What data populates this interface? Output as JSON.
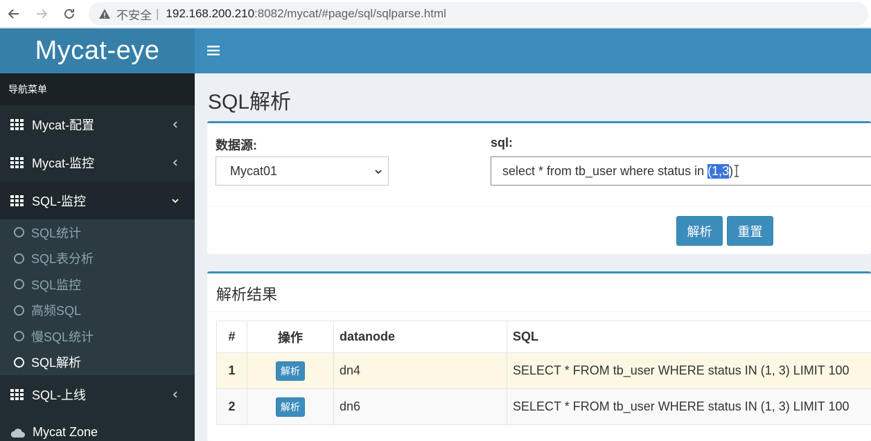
{
  "browser": {
    "insecure_label": "不安全",
    "separator": "|",
    "url_host": "192.168.200.210",
    "url_path": ":8082/mycat/#page/sql/sqlparse.html"
  },
  "sidebar": {
    "logo": "Mycat-eye",
    "menu_header": "导航菜单",
    "items": [
      {
        "label": "Mycat-配置",
        "icon": "grid-icon",
        "chevron": "chevron-left-icon"
      },
      {
        "label": "Mycat-监控",
        "icon": "grid-icon",
        "chevron": "chevron-left-icon"
      },
      {
        "label": "SQL-监控",
        "icon": "grid-icon",
        "chevron": "chevron-down-icon"
      },
      {
        "label": "SQL-上线",
        "icon": "grid-icon",
        "chevron": "chevron-left-icon"
      },
      {
        "label": "Mycat Zone",
        "icon": "cloud-icon"
      }
    ],
    "submenu": [
      {
        "label": "SQL统计"
      },
      {
        "label": "SQL表分析"
      },
      {
        "label": "SQL监控"
      },
      {
        "label": "高频SQL"
      },
      {
        "label": "慢SQL统计"
      },
      {
        "label": "SQL解析"
      }
    ]
  },
  "page": {
    "title": "SQL解析"
  },
  "form": {
    "datasource_label": "数据源:",
    "datasource_value": "Mycat01",
    "sql_label": "sql:",
    "sql_prefix": "select * from tb_user where status in ",
    "sql_selected": "(1,3",
    "sql_suffix": ")",
    "parse_button": "解析",
    "reset_button": "重置"
  },
  "results": {
    "title": "解析结果",
    "columns": [
      "#",
      "操作",
      "datanode",
      "SQL"
    ],
    "rows": [
      {
        "num": "1",
        "action": "解析",
        "datanode": "dn4",
        "sql": "SELECT * FROM tb_user WHERE status IN (1, 3) LIMIT 100"
      },
      {
        "num": "2",
        "action": "解析",
        "datanode": "dn6",
        "sql": "SELECT * FROM tb_user WHERE status IN (1, 3) LIMIT 100"
      }
    ]
  },
  "colors": {
    "brand": "#3c8dbc",
    "brand_dark": "#367fa9",
    "sidebar_bg": "#222d32",
    "highlight_row": "#fcf8e3"
  }
}
